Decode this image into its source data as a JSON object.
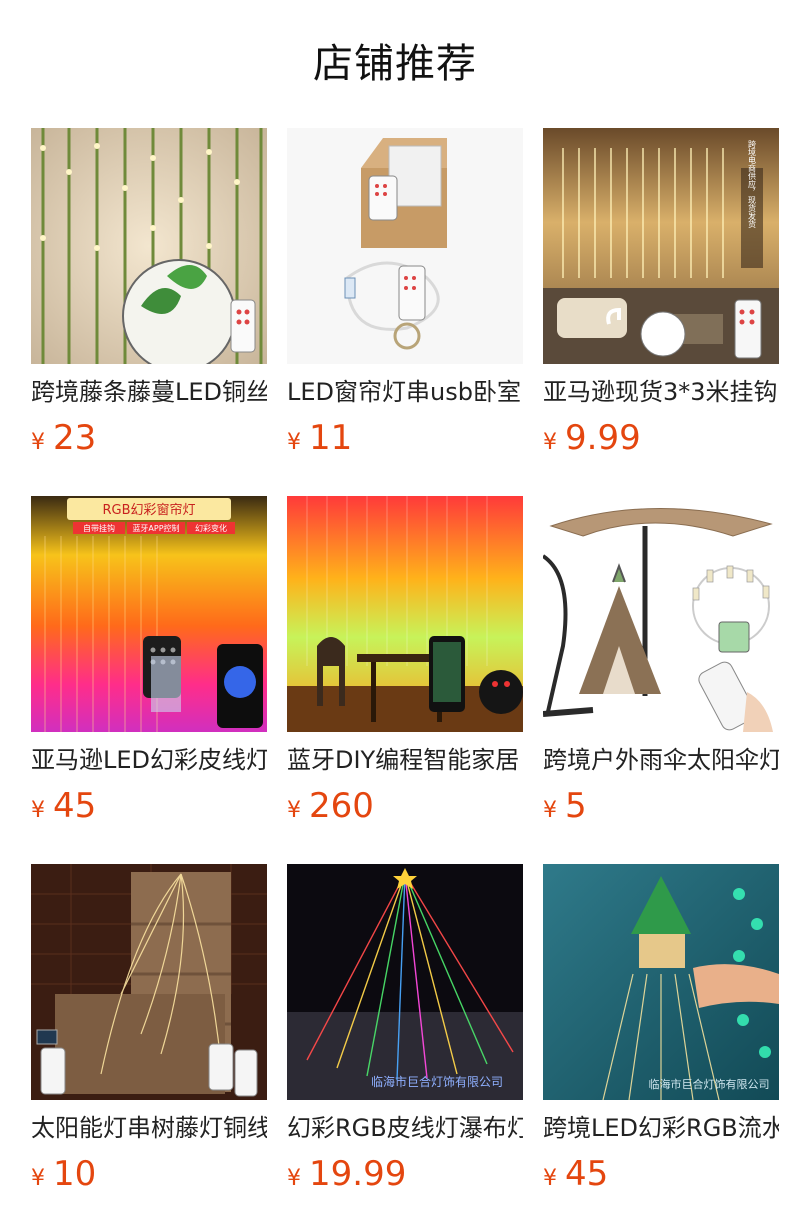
{
  "page": {
    "title": "店铺推荐"
  },
  "currency_symbol": "¥",
  "products": [
    {
      "name": "跨境藤条藤蔓LED铜丝",
      "price": "23",
      "image": "vine-curtain-lights-image"
    },
    {
      "name": "LED窗帘灯串usb卧室",
      "price": "11",
      "image": "boxed-light-string-image"
    },
    {
      "name": "亚马逊现货3*3米挂钩",
      "price": "9.99",
      "image": "living-room-curtain-lights-image"
    },
    {
      "name": "亚马逊LED幻彩皮线灯",
      "price": "45",
      "image": "rgb-curtain-lights-image"
    },
    {
      "name": "蓝牙DIY编程智能家居",
      "price": "260",
      "image": "diy-rgb-dining-room-image"
    },
    {
      "name": "跨境户外雨伞太阳伞灯",
      "price": "5",
      "image": "umbrella-tent-lights-image"
    },
    {
      "name": "太阳能灯串树藤灯铜线",
      "price": "10",
      "image": "solar-vine-lights-image"
    },
    {
      "name": "幻彩RGB皮线灯瀑布灯",
      "price": "19.99",
      "image": "rgb-waterfall-tree-image"
    },
    {
      "name": "跨境LED幻彩RGB流水灯",
      "price": "45",
      "image": "christmas-rgb-lights-image"
    }
  ],
  "watermarks": {
    "p8": "临海市巨合灯饰有限公司",
    "p9": "临海市巨合灯饰有限公司"
  },
  "product_image_texts": {
    "p3_vertical": "跨境电商供应，现货发货",
    "p4_banner": "RGB幻彩窗帘灯",
    "p4_tags": [
      "自带挂钩",
      "蓝牙APP控制",
      "幻彩变化"
    ]
  }
}
